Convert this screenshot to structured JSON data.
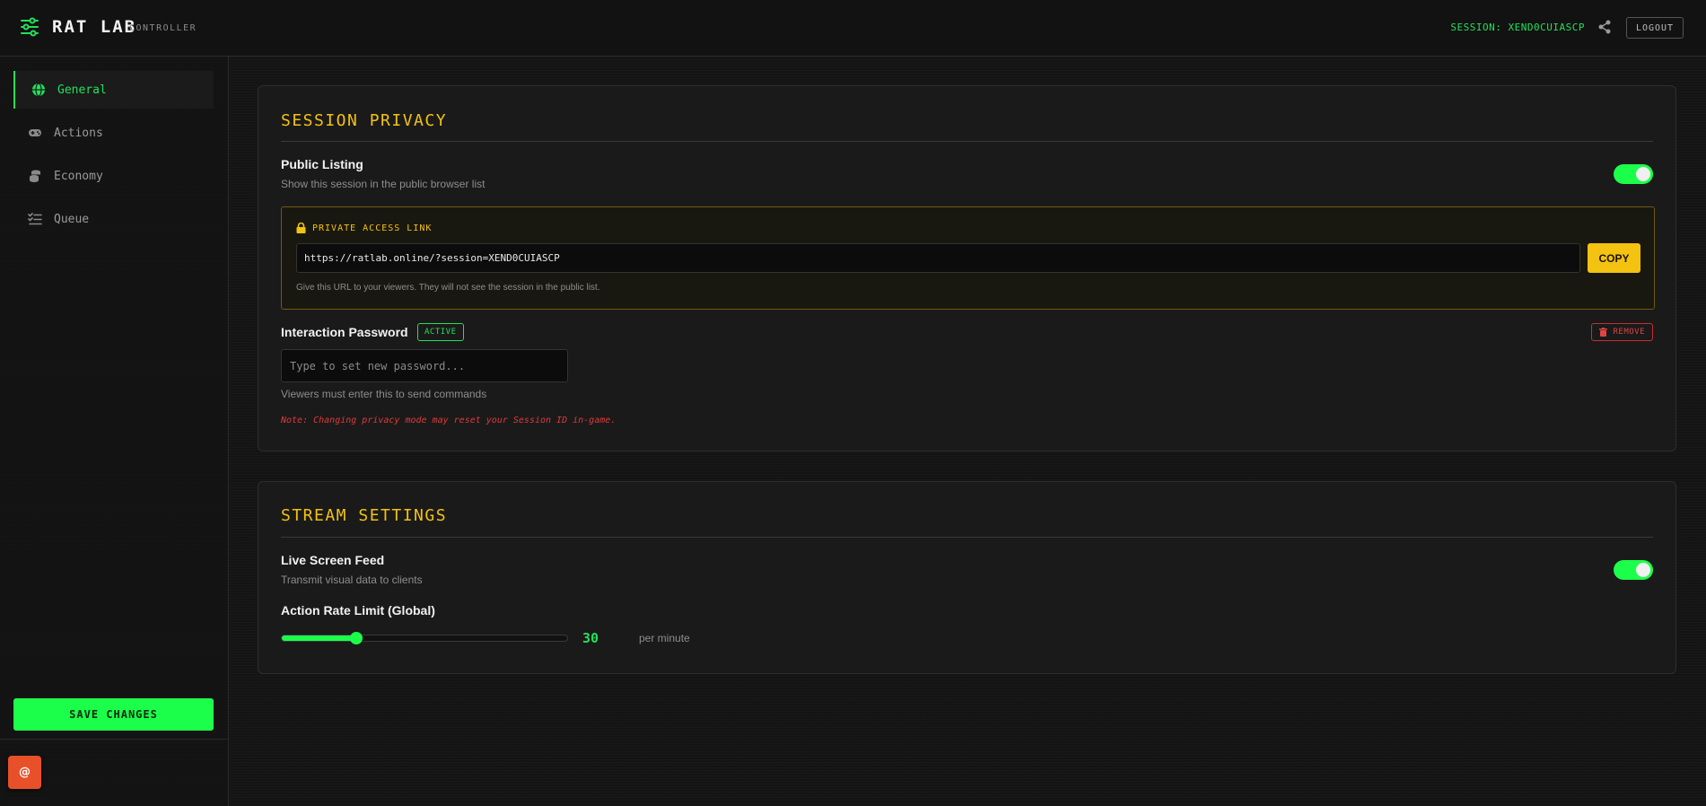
{
  "header": {
    "logo_icon": "sliders-icon",
    "title": "RAT LAB",
    "subtitle": "CONTROLLER",
    "session_label": "SESSION: XEND0CUIASCP",
    "share_icon": "share-icon",
    "logout_label": "LOGOUT"
  },
  "sidebar": {
    "items": [
      {
        "label": "General",
        "icon": "globe-icon",
        "active": true
      },
      {
        "label": "Actions",
        "icon": "gamepad-icon",
        "active": false
      },
      {
        "label": "Economy",
        "icon": "coins-icon",
        "active": false
      },
      {
        "label": "Queue",
        "icon": "list-check-icon",
        "active": false
      }
    ],
    "save_label": "SAVE CHANGES",
    "badge_label": "@"
  },
  "session_privacy": {
    "title": "SESSION PRIVACY",
    "public_listing": {
      "title": "Public Listing",
      "description": "Show this session in the public browser list",
      "enabled": true
    },
    "private_access": {
      "label": "PRIVATE ACCESS LINK",
      "icon": "lock-icon",
      "url": "https://ratlab.online/?session=XEND0CUIASCP",
      "copy_label": "COPY",
      "hint": "Give this URL to your viewers. They will not see the session in the public list."
    },
    "password": {
      "title": "Interaction Password",
      "badge": "ACTIVE",
      "remove_label": "REMOVE",
      "remove_icon": "trash-icon",
      "placeholder": "Type to set new password...",
      "description": "Viewers must enter this to send commands"
    },
    "note": "Note: Changing privacy mode may reset your Session ID in-game."
  },
  "stream_settings": {
    "title": "STREAM SETTINGS",
    "live_feed": {
      "title": "Live Screen Feed",
      "description": "Transmit visual data to clients",
      "enabled": true
    },
    "rate_limit": {
      "title": "Action Rate Limit (Global)",
      "value": "30",
      "unit": "per minute",
      "fraction": 0.26
    }
  },
  "colors": {
    "accent_green": "#1cff4a",
    "accent_yellow": "#f4c211",
    "danger_red": "#e04444",
    "background": "#141414"
  }
}
